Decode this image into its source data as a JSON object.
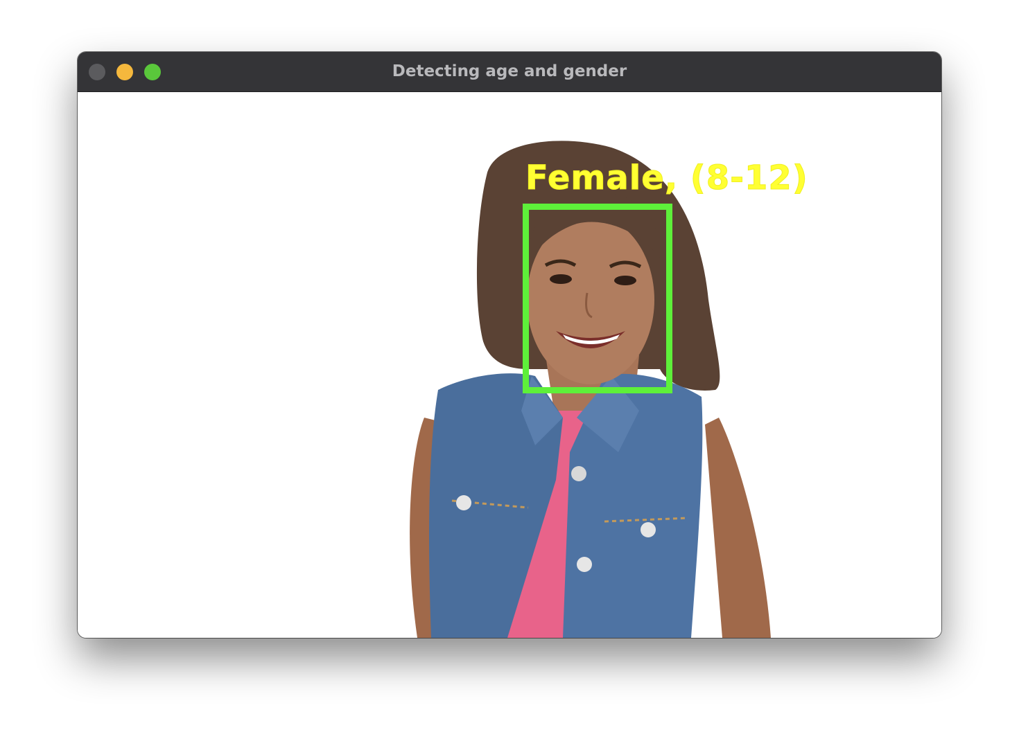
{
  "window": {
    "title": "Detecting age and gender"
  },
  "detection": {
    "label": "Female,  (8-12)",
    "box_color": "#5ef03a",
    "label_color": "#ffff33"
  },
  "colors": {
    "titlebar": "#343437",
    "close": "#5b5b5e",
    "minimize": "#f5b83d",
    "maximize": "#5ac73b"
  }
}
